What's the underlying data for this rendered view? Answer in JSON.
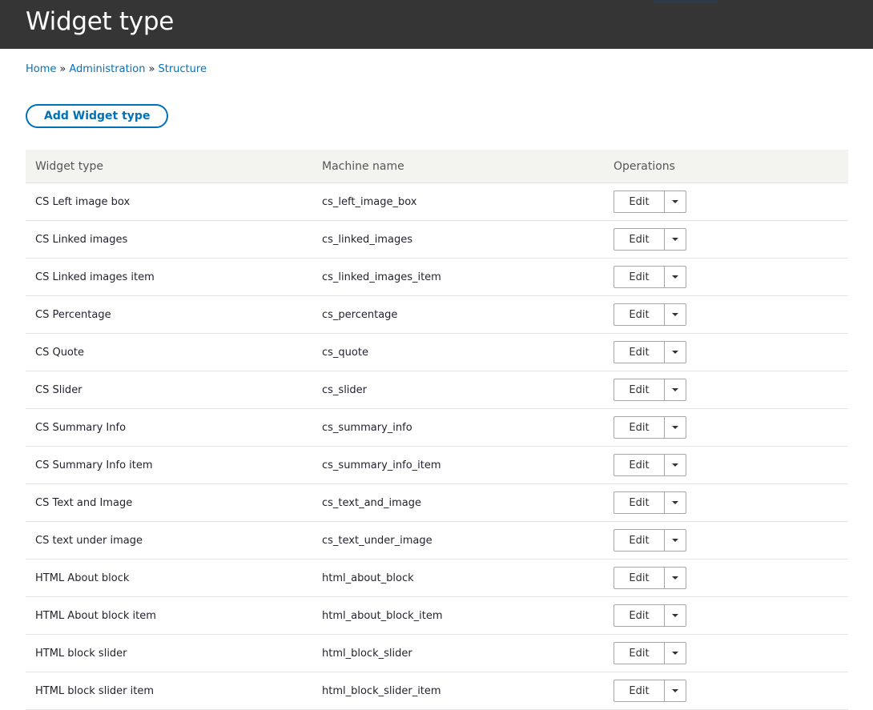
{
  "header": {
    "title": "Widget type"
  },
  "breadcrumb": [
    {
      "label": "Home"
    },
    {
      "label": "Administration"
    },
    {
      "label": "Structure"
    }
  ],
  "breadcrumb_separator": "»",
  "actions": {
    "add_label": "Add Widget type"
  },
  "table": {
    "columns": [
      "Widget type",
      "Machine name",
      "Operations"
    ],
    "edit_label": "Edit",
    "rows": [
      {
        "label": "CS Left image box",
        "machine": "cs_left_image_box"
      },
      {
        "label": "CS Linked images",
        "machine": "cs_linked_images"
      },
      {
        "label": "CS Linked images item",
        "machine": "cs_linked_images_item"
      },
      {
        "label": "CS Percentage",
        "machine": "cs_percentage"
      },
      {
        "label": "CS Quote",
        "machine": "cs_quote"
      },
      {
        "label": "CS Slider",
        "machine": "cs_slider"
      },
      {
        "label": "CS Summary Info",
        "machine": "cs_summary_info"
      },
      {
        "label": "CS Summary Info item",
        "machine": "cs_summary_info_item"
      },
      {
        "label": "CS Text and Image",
        "machine": "cs_text_and_image"
      },
      {
        "label": "CS text under image",
        "machine": "cs_text_under_image"
      },
      {
        "label": "HTML About block",
        "machine": "html_about_block"
      },
      {
        "label": "HTML About block item",
        "machine": "html_about_block_item"
      },
      {
        "label": "HTML block slider",
        "machine": "html_block_slider"
      },
      {
        "label": "HTML block slider item",
        "machine": "html_block_slider_item"
      }
    ]
  },
  "colors": {
    "header_bg": "#353535",
    "link": "#0074bd",
    "button_border": "#0071b8",
    "table_header_bg": "#f3f3f0"
  },
  "icons": {
    "operations_toggle": "caret-down-icon"
  }
}
